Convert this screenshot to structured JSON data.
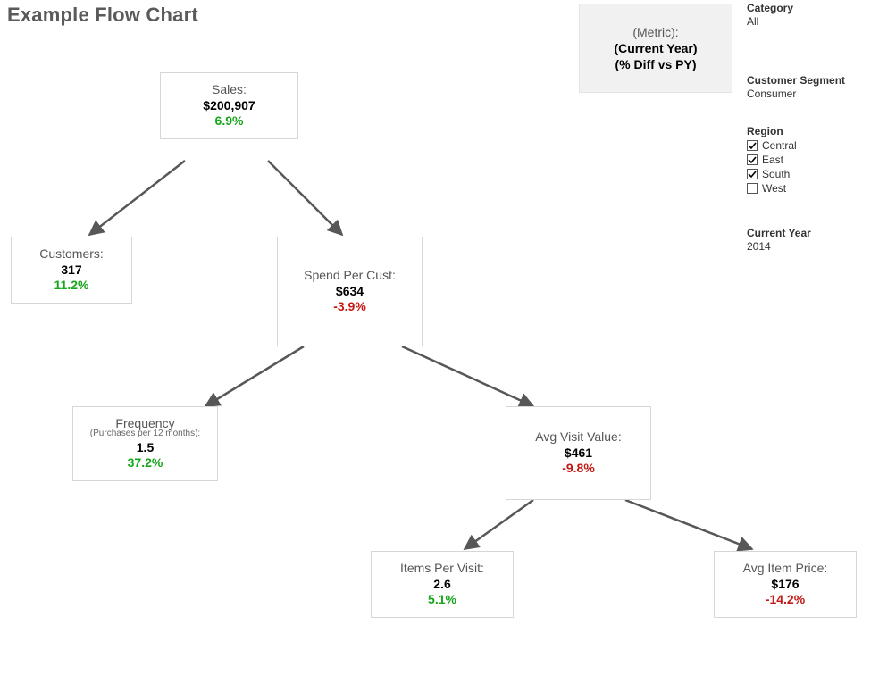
{
  "title": "Example Flow Chart",
  "legend": {
    "line1": "(Metric):",
    "line2": "(Current Year)",
    "line3": "(% Diff vs PY)"
  },
  "nodes": {
    "sales": {
      "label": "Sales:",
      "value": "$200,907",
      "diff": "6.9%",
      "dir": "up"
    },
    "customers": {
      "label": "Customers:",
      "value": "317",
      "diff": "11.2%",
      "dir": "up"
    },
    "spend": {
      "label": "Spend Per Cust:",
      "value": "$634",
      "diff": "-3.9%",
      "dir": "down"
    },
    "frequency": {
      "label": "Frequency",
      "sublabel": "(Purchases per 12 months):",
      "value": "1.5",
      "diff": "37.2%",
      "dir": "up"
    },
    "avgvisit": {
      "label": "Avg Visit Value:",
      "value": "$461",
      "diff": "-9.8%",
      "dir": "down"
    },
    "itemspervisit": {
      "label": "Items Per Visit:",
      "value": "2.6",
      "diff": "5.1%",
      "dir": "up"
    },
    "avgitemprice": {
      "label": "Avg Item Price:",
      "value": "$176",
      "diff": "-14.2%",
      "dir": "down"
    }
  },
  "filters": {
    "category": {
      "title": "Category",
      "value": "All"
    },
    "segment": {
      "title": "Customer Segment",
      "value": "Consumer"
    },
    "region": {
      "title": "Region",
      "options": [
        {
          "label": "Central",
          "checked": true
        },
        {
          "label": "East",
          "checked": true
        },
        {
          "label": "South",
          "checked": true
        },
        {
          "label": "West",
          "checked": false
        }
      ]
    },
    "year": {
      "title": "Current Year",
      "value": "2014"
    }
  }
}
